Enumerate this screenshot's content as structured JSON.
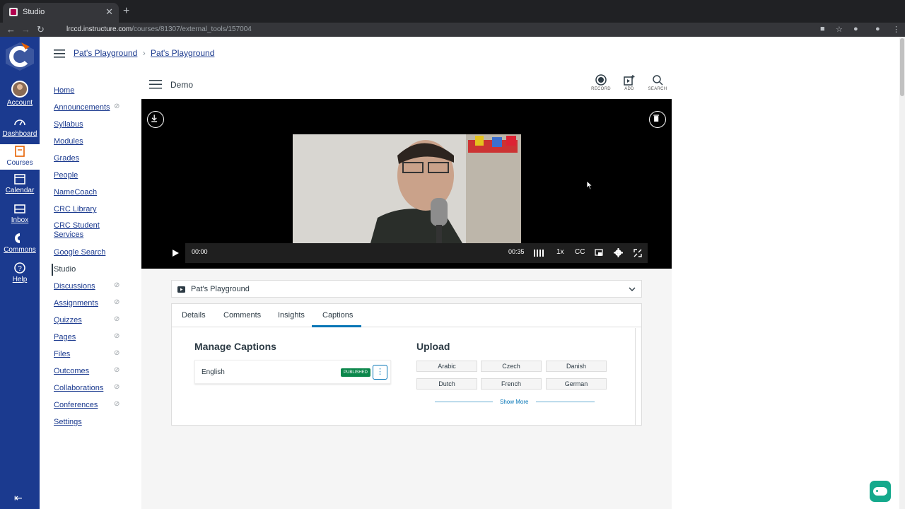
{
  "browser": {
    "tab_title": "Studio",
    "url_host": "lrccd.instructure.com",
    "url_path": "/courses/81307/external_tools/157004"
  },
  "global_nav": {
    "items": [
      {
        "label": "Account",
        "icon": "avatar-icon"
      },
      {
        "label": "Dashboard",
        "icon": "dashboard-icon"
      },
      {
        "label": "Courses",
        "icon": "courses-icon"
      },
      {
        "label": "Calendar",
        "icon": "calendar-icon"
      },
      {
        "label": "Inbox",
        "icon": "inbox-icon"
      },
      {
        "label": "Commons",
        "icon": "commons-icon"
      },
      {
        "label": "Help",
        "icon": "help-icon"
      }
    ]
  },
  "breadcrumb": [
    "Pat's Playground",
    "Pat's Playground"
  ],
  "course_nav": [
    {
      "label": "Home",
      "hidden": false
    },
    {
      "label": "Announcements",
      "hidden": true
    },
    {
      "label": "Syllabus",
      "hidden": false
    },
    {
      "label": "Modules",
      "hidden": false
    },
    {
      "label": "Grades",
      "hidden": false
    },
    {
      "label": "People",
      "hidden": false
    },
    {
      "label": "NameCoach",
      "hidden": false
    },
    {
      "label": "CRC Library",
      "hidden": false
    },
    {
      "label": "CRC Student Services",
      "hidden": false
    },
    {
      "label": "Google Search",
      "hidden": false
    },
    {
      "label": "Studio",
      "hidden": false,
      "active": true
    },
    {
      "label": "Discussions",
      "hidden": true
    },
    {
      "label": "Assignments",
      "hidden": true
    },
    {
      "label": "Quizzes",
      "hidden": true
    },
    {
      "label": "Pages",
      "hidden": true
    },
    {
      "label": "Files",
      "hidden": true
    },
    {
      "label": "Outcomes",
      "hidden": true
    },
    {
      "label": "Collaborations",
      "hidden": true
    },
    {
      "label": "Conferences",
      "hidden": true
    },
    {
      "label": "Settings",
      "hidden": false
    }
  ],
  "studio": {
    "title": "Demo",
    "actions": [
      "RECORD",
      "ADD",
      "SEARCH"
    ]
  },
  "player": {
    "current_time": "00:00",
    "duration": "00:35",
    "speed": "1x",
    "cc": "CC"
  },
  "collection_select": "Pat's Playground",
  "tabs": [
    "Details",
    "Comments",
    "Insights",
    "Captions"
  ],
  "active_tab": "Captions",
  "captions": {
    "manage_title": "Manage Captions",
    "language": "English",
    "status": "PUBLISHED",
    "upload_title": "Upload",
    "upload_languages": [
      "Arabic",
      "Czech",
      "Danish",
      "Dutch",
      "French",
      "German"
    ],
    "show_more": "Show More"
  },
  "colors": {
    "nav_bg": "#1b3a8f",
    "link": "#1b3a8f",
    "accent": "#0374b5",
    "published": "#0b874b"
  }
}
